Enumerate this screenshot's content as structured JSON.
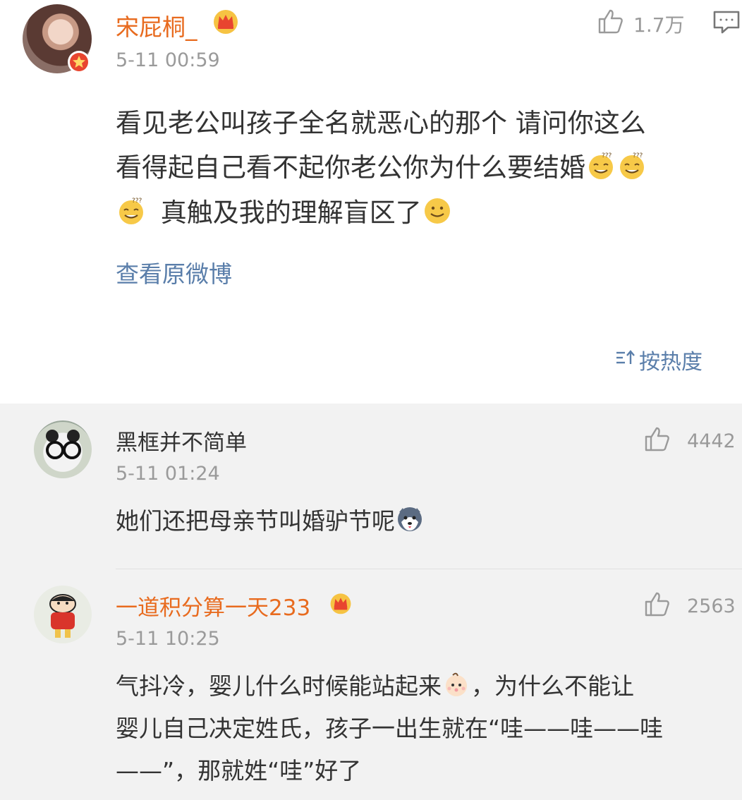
{
  "post": {
    "username": "宋屁桐_",
    "timestamp": "5-11 00:59",
    "likes": "1.7万",
    "content_lines": [
      "看见老公叫孩子全名就恶心的那个 请问你这么",
      "看得起自己看不起你老公你为什么要结婚",
      "真触及我的理解盲区了"
    ],
    "view_original": "查看原微博",
    "sort_label": "按热度"
  },
  "replies": [
    {
      "username": "黑框并不简单",
      "timestamp": "5-11 01:24",
      "likes": "4442",
      "content_lines": [
        "她们还把母亲节叫婚驴节呢"
      ]
    },
    {
      "username": "一道积分算一天233",
      "timestamp": "5-11 10:25",
      "likes": "2563",
      "content_lines": [
        "气抖冷，婴儿什么时候能站起来",
        "，为什么不能让",
        "婴儿自己决定姓氏，孩子一出生就在“哇——哇——哇",
        "——”，那就姓“哇”好了"
      ]
    }
  ],
  "colors": {
    "vip_name": "#e86b1f",
    "normal_name": "#333333",
    "link": "#5a7eaa",
    "meta": "#9a9a9a",
    "body_text": "#333333",
    "reply_bg": "#f2f2f2"
  },
  "icons": [
    "crown-icon",
    "vip-badge-icon",
    "thumbs-up-icon",
    "comment-icon",
    "sort-icon",
    "sweat-smile-emoji",
    "smile-emoji",
    "husky-emoji",
    "baby-emoji"
  ]
}
